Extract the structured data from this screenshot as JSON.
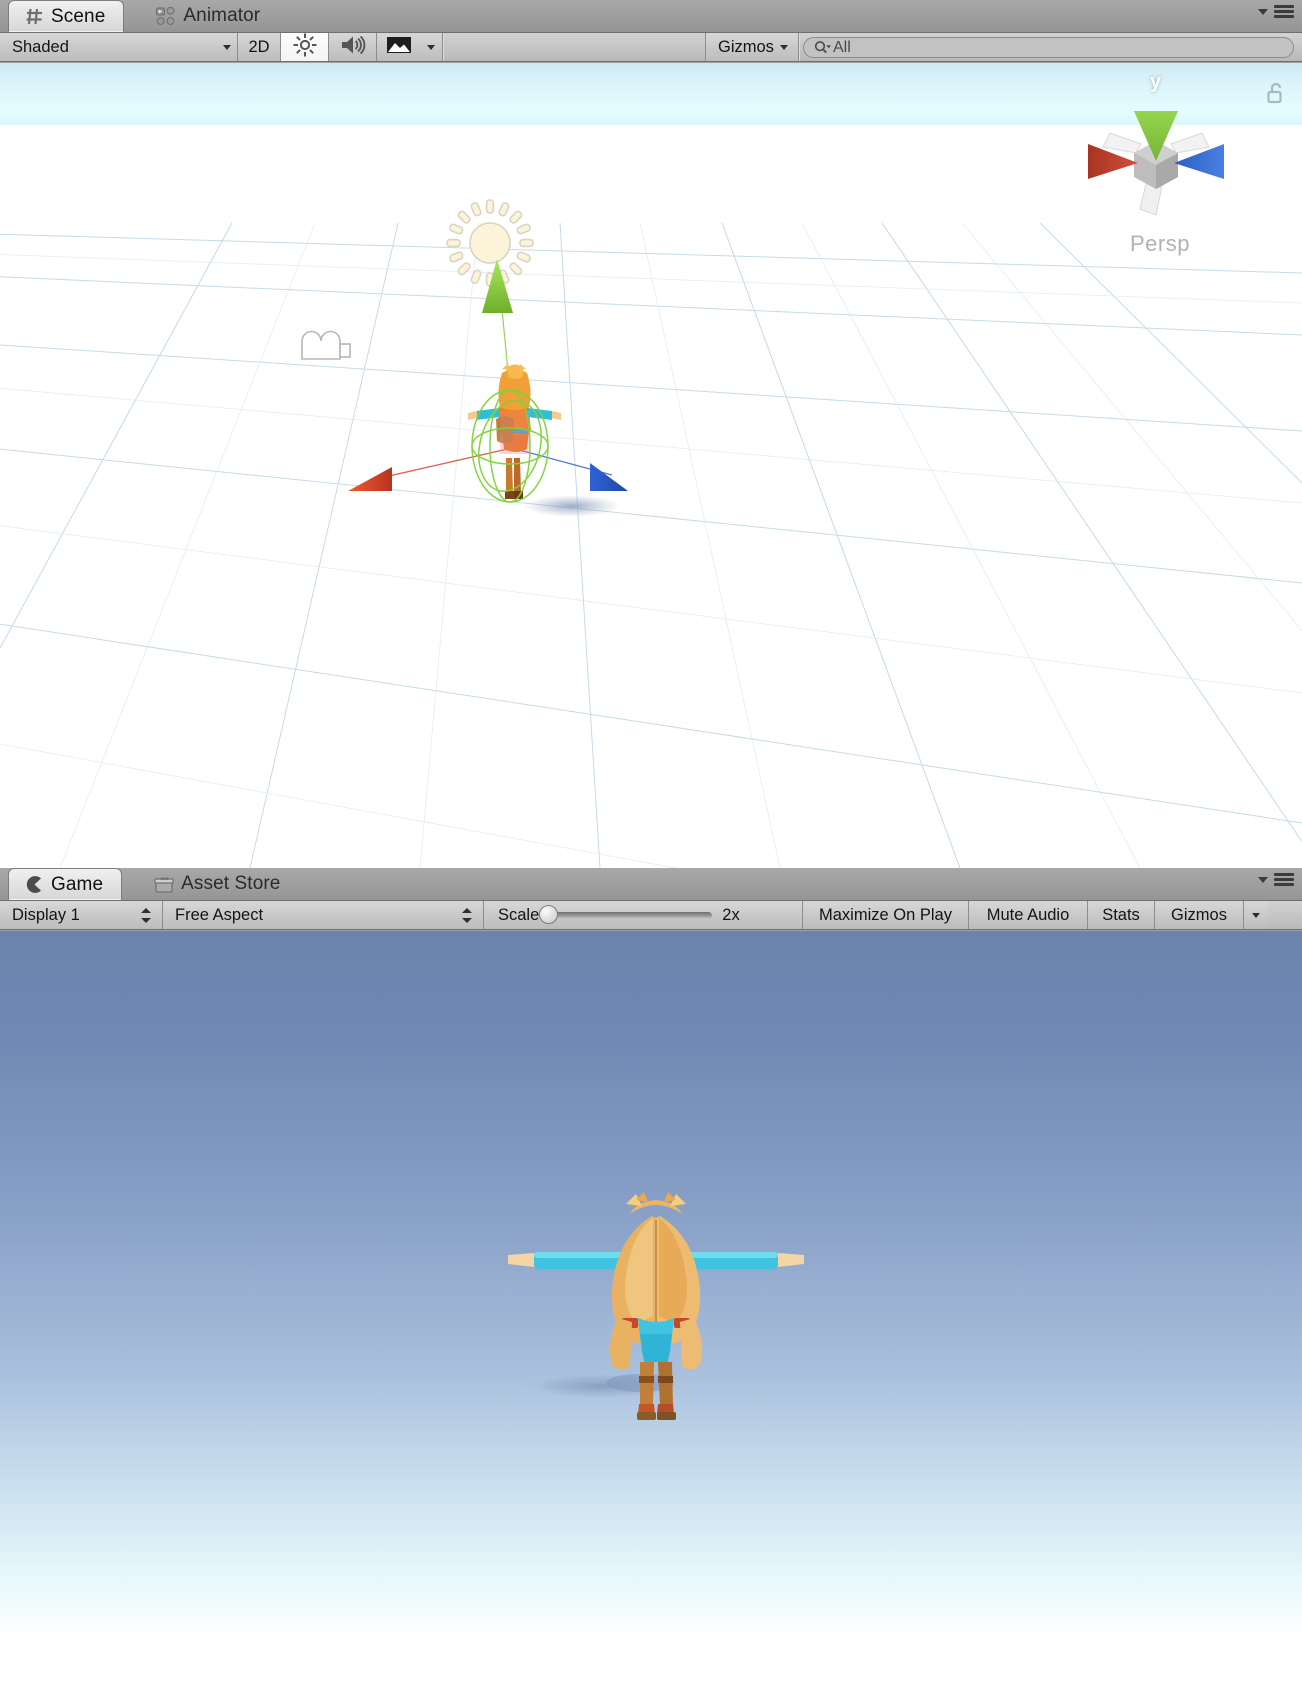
{
  "scene_panel": {
    "tabs": [
      {
        "label": "Scene",
        "icon": "grid-icon",
        "active": true
      },
      {
        "label": "Animator",
        "icon": "animator-nodes-icon",
        "active": false
      }
    ],
    "toolbar": {
      "draw_mode": "Shaded",
      "draw_mode_icon": "chevron-down-icon",
      "two_d_toggle": "2D",
      "lighting_icon": "sun-icon",
      "audio_icon": "speaker-icon",
      "fx_icon": "image-icon",
      "fx_caret_icon": "chevron-down-icon",
      "gizmos_label": "Gizmos",
      "gizmos_caret_icon": "chevron-down-icon",
      "search_icon": "search-icon",
      "search_value": "All",
      "search_placeholder": "All"
    },
    "viewport": {
      "persp_label": "Persp",
      "axis_y_label": "y",
      "lock_icon": "unlocked-padlock-icon",
      "gizmo_axis_colors": {
        "x": "#c1452f",
        "y": "#8cc63f",
        "z": "#2e62c8",
        "center": "#b9b9b9"
      },
      "handle_colors": {
        "x_arrow": "#e8502a",
        "y_arrow": "#8ddc3e",
        "z_arrow": "#2c63d8",
        "rotation_ring": "#7fd23a"
      },
      "gizmo_icons": [
        {
          "name": "directional-light-gizmo",
          "icon": "sun-gizmo-icon"
        },
        {
          "name": "camera-gizmo",
          "icon": "camera-icon"
        }
      ],
      "sky_color_top": "#cfe9f2",
      "sky_color_bottom": "#e4fcff",
      "ground_color": "#ffffff",
      "grid_color": "#c8dbe6"
    }
  },
  "game_panel": {
    "tabs": [
      {
        "label": "Game",
        "icon": "game-pacman-icon",
        "active": true
      },
      {
        "label": "Asset Store",
        "icon": "shopping-bag-icon",
        "active": false
      }
    ],
    "toolbar": {
      "display": "Display 1",
      "display_stepper_icon": "up-down-caret-icon",
      "aspect": "Free Aspect",
      "aspect_stepper_icon": "up-down-caret-icon",
      "scale_label": "Scale",
      "scale_value": "2x",
      "scale_percent": 0,
      "maximize_on_play": "Maximize On Play",
      "mute_audio": "Mute Audio",
      "stats": "Stats",
      "gizmos": "Gizmos",
      "gizmos_caret_icon": "chevron-down-icon"
    },
    "viewport": {
      "sky_top_color": "#6c83ad",
      "sky_horizon_color": "#e8f8fb",
      "ground_color": "#ffffff",
      "character_hair_color": "#e8b060",
      "character_cloth_color": "#3fc3e0",
      "shadow_color": "#8fa8c8"
    }
  },
  "window_menu": {
    "caret_icon": "small-caret-down-icon",
    "hamburger_icon": "hamburger-menu-icon"
  }
}
